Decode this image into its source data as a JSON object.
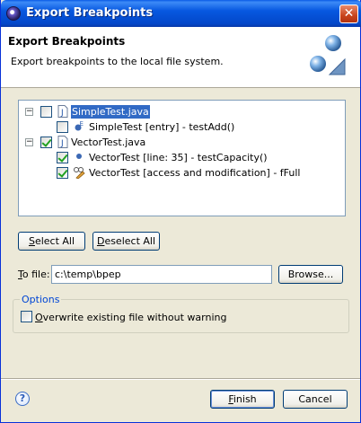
{
  "window": {
    "title": "Export Breakpoints",
    "close_glyph": "✕",
    "title_icon": "eclipse-icon"
  },
  "banner": {
    "title": "Export Breakpoints",
    "description": "Export breakpoints to the local file system.",
    "graphic_icon": "export-wizard-banner-icon"
  },
  "tree": {
    "items": [
      {
        "label": "SimpleTest.java",
        "checked": false,
        "expanded": true,
        "selected": true,
        "icon": "java-file-icon",
        "level": 0
      },
      {
        "label": "SimpleTest [entry] - testAdd()",
        "checked": false,
        "icon": "method-breakpoint-icon",
        "level": 1
      },
      {
        "label": "VectorTest.java",
        "checked": true,
        "expanded": true,
        "selected": false,
        "icon": "java-file-icon",
        "level": 0
      },
      {
        "label": "VectorTest [line: 35] - testCapacity()",
        "checked": true,
        "icon": "line-breakpoint-icon",
        "level": 1
      },
      {
        "label": "VectorTest [access and modification] - fFull",
        "checked": true,
        "icon": "watchpoint-icon",
        "level": 1
      }
    ]
  },
  "buttons": {
    "select_all": {
      "mnemonic": "S",
      "rest": "elect All"
    },
    "deselect_all": {
      "mnemonic": "D",
      "rest": "eselect All"
    },
    "browse": "Browse...",
    "finish": {
      "mnemonic": "F",
      "rest": "inish"
    },
    "cancel": "Cancel"
  },
  "to_file": {
    "label_mnemonic": "T",
    "label_rest": "o file:",
    "value": "c:\\temp\\bpep"
  },
  "options": {
    "legend": "Options",
    "overwrite": {
      "mnemonic": "O",
      "rest": "verwrite existing file without warning",
      "checked": false
    }
  },
  "help": {
    "glyph": "?"
  }
}
